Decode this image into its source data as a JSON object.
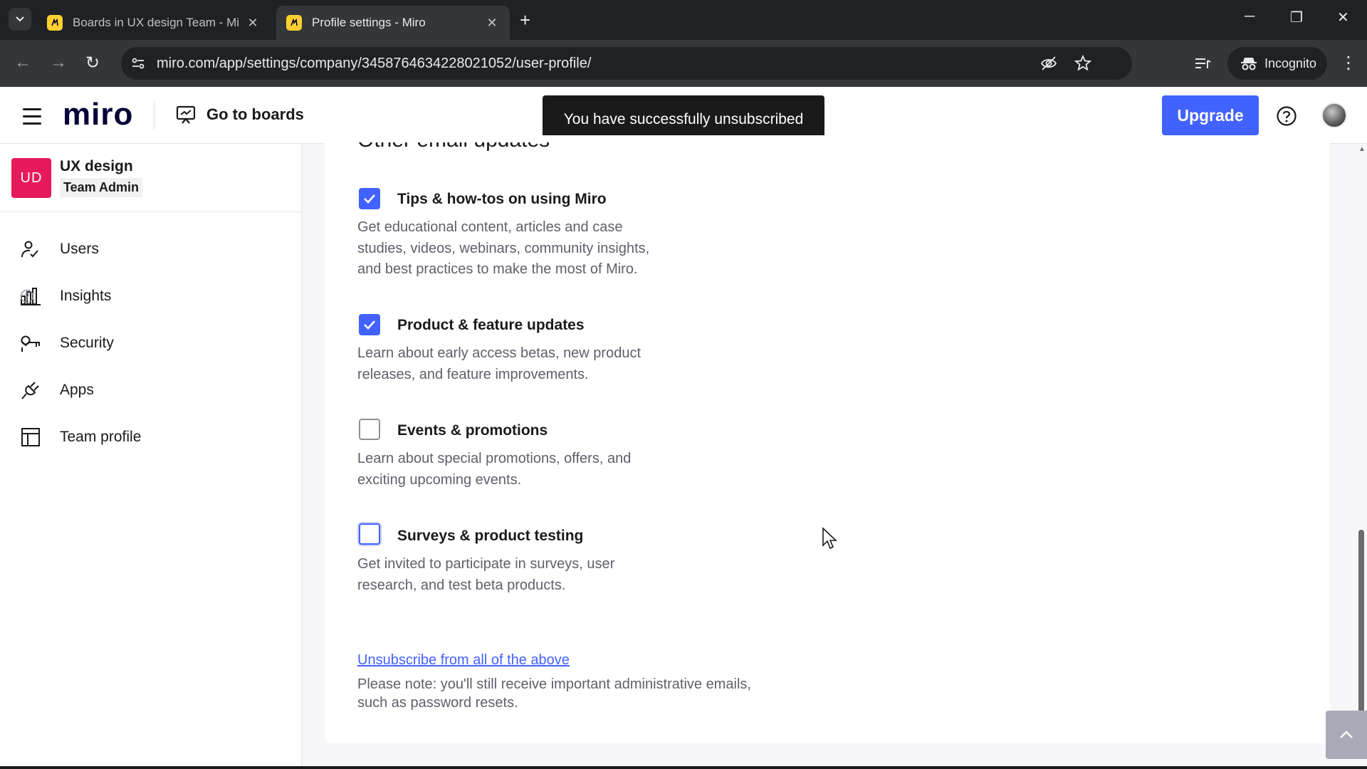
{
  "browser": {
    "tabs": [
      {
        "title": "Boards in UX design Team - Mi",
        "active": false
      },
      {
        "title": "Profile settings - Miro",
        "active": true
      }
    ],
    "url": "miro.com/app/settings/company/3458764634228021052/user-profile/",
    "incognito_label": "Incognito"
  },
  "header": {
    "logo": "miro",
    "go_to_boards": "Go to boards",
    "upgrade": "Upgrade"
  },
  "toast": "You have successfully unsubscribed",
  "sidebar": {
    "team_initials": "UD",
    "team_name": "UX design",
    "team_role": "Team Admin",
    "items": [
      {
        "label": "Users"
      },
      {
        "label": "Insights"
      },
      {
        "label": "Security"
      },
      {
        "label": "Apps"
      },
      {
        "label": "Team profile"
      }
    ]
  },
  "content": {
    "section_title": "Other email updates",
    "prefs": [
      {
        "title": "Tips & how-tos on using Miro",
        "checked": true,
        "desc_lines": [
          "Get educational content, articles and case",
          "studies, videos, webinars, community insights,",
          "and best practices to make the most of Miro."
        ]
      },
      {
        "title": "Product & feature updates",
        "checked": true,
        "desc_lines": [
          "Learn about early access betas, new product",
          "releases, and feature improvements."
        ]
      },
      {
        "title": "Events & promotions",
        "checked": false,
        "desc_lines": [
          "Learn about special promotions, offers, and",
          "exciting upcoming events."
        ]
      },
      {
        "title": "Surveys & product testing",
        "checked": false,
        "desc_lines": [
          "Get invited to participate in surveys, user",
          "research, and test beta products."
        ]
      }
    ],
    "unsubscribe_all": "Unsubscribe from all of the above",
    "note_lines": [
      "Please note: you'll still receive important administrative emails,",
      "such as password resets."
    ]
  },
  "colors": {
    "accent": "#4262ff",
    "team_badge": "#e6195a",
    "toast_bg": "#1a1a1a"
  }
}
